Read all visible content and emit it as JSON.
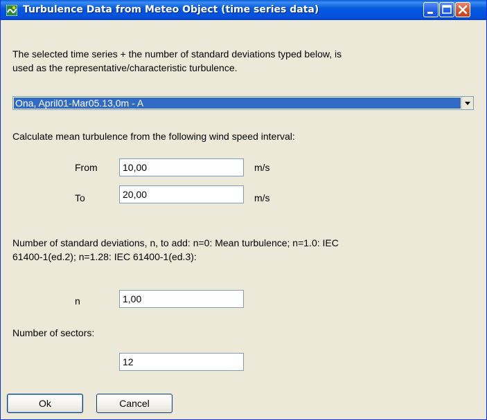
{
  "window": {
    "title": "Turbulence Data from Meteo Object (time series data)",
    "icon": "meteo-app-icon"
  },
  "intro_text_line1": "The selected time series + the number of standard deviations typed below, is",
  "intro_text_line2": "used as the representative/characteristic turbulence.",
  "time_series_select": {
    "selected": "Ona, April01-Mar05.13,0m - A"
  },
  "interval_text": "Calculate mean turbulence from the following wind speed interval:",
  "from": {
    "label": "From",
    "value": "10,00",
    "unit": "m/s"
  },
  "to": {
    "label": "To",
    "value": "20,00",
    "unit": "m/s"
  },
  "std_text_line1": "Number of standard deviations, n, to add: n=0: Mean turbulence; n=1.0: IEC",
  "std_text_line2": "61400-1(ed.2); n=1.28: IEC 61400-1(ed.3):",
  "n": {
    "label": "n",
    "value": "1,00"
  },
  "sectors": {
    "label": "Number of sectors:",
    "value": "12"
  },
  "buttons": {
    "ok": "Ok",
    "cancel": "Cancel"
  },
  "colors": {
    "titlebar": "#0054e3",
    "selection": "#316ac5",
    "dialog_bg": "#ece9d8"
  }
}
